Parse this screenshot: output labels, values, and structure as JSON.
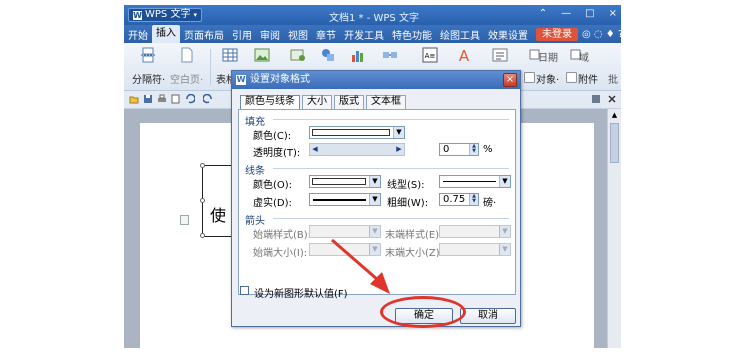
{
  "titlebar": {
    "app_name": "WPS 文字",
    "doc_title": "文档1 * - WPS 文字",
    "minimize": "—",
    "restore": "□",
    "close": "×"
  },
  "menu": {
    "items": [
      "开始",
      "插入",
      "页面布局",
      "引用",
      "审阅",
      "视图",
      "章节",
      "开发工具",
      "特色功能",
      "绘图工具",
      "效果设置"
    ],
    "active": "插入",
    "login": "未登录",
    "right_icons": "◎ ◌ ♦ ?·"
  },
  "ribbon": {
    "page_break": "分隔符·",
    "blank_page": "空白页·",
    "table": "表格",
    "object": "对象·",
    "attachment": "附件",
    "date": "日期",
    "field": "域",
    "trailing": "批"
  },
  "dialog": {
    "title": "设置对象格式",
    "close": "×",
    "tabs": [
      "颜色与线条",
      "大小",
      "版式",
      "文本框"
    ],
    "selected_tab": "颜色与线条",
    "fill": {
      "section": "填充",
      "color_label": "颜色(C):",
      "transparency_label": "透明度(T):",
      "transparency_value": "0",
      "transparency_unit": "%"
    },
    "line": {
      "section": "线条",
      "color_label": "颜色(O):",
      "style_label": "线型(S):",
      "dash_label": "虚实(D):",
      "weight_label": "粗细(W):",
      "weight_value": "0.75",
      "weight_unit": "磅·"
    },
    "arrows": {
      "section": "箭头",
      "begin_style": "始端样式(B):",
      "end_style": "末端样式(E):",
      "begin_size": "始端大小(I):",
      "end_size": "末端大小(Z):"
    },
    "default_checkbox": "设为新图形默认值(F)",
    "ok": "确定",
    "cancel": "取消"
  },
  "document": {
    "shape_text": "使"
  },
  "annotation": {
    "color": "#e0352a"
  }
}
